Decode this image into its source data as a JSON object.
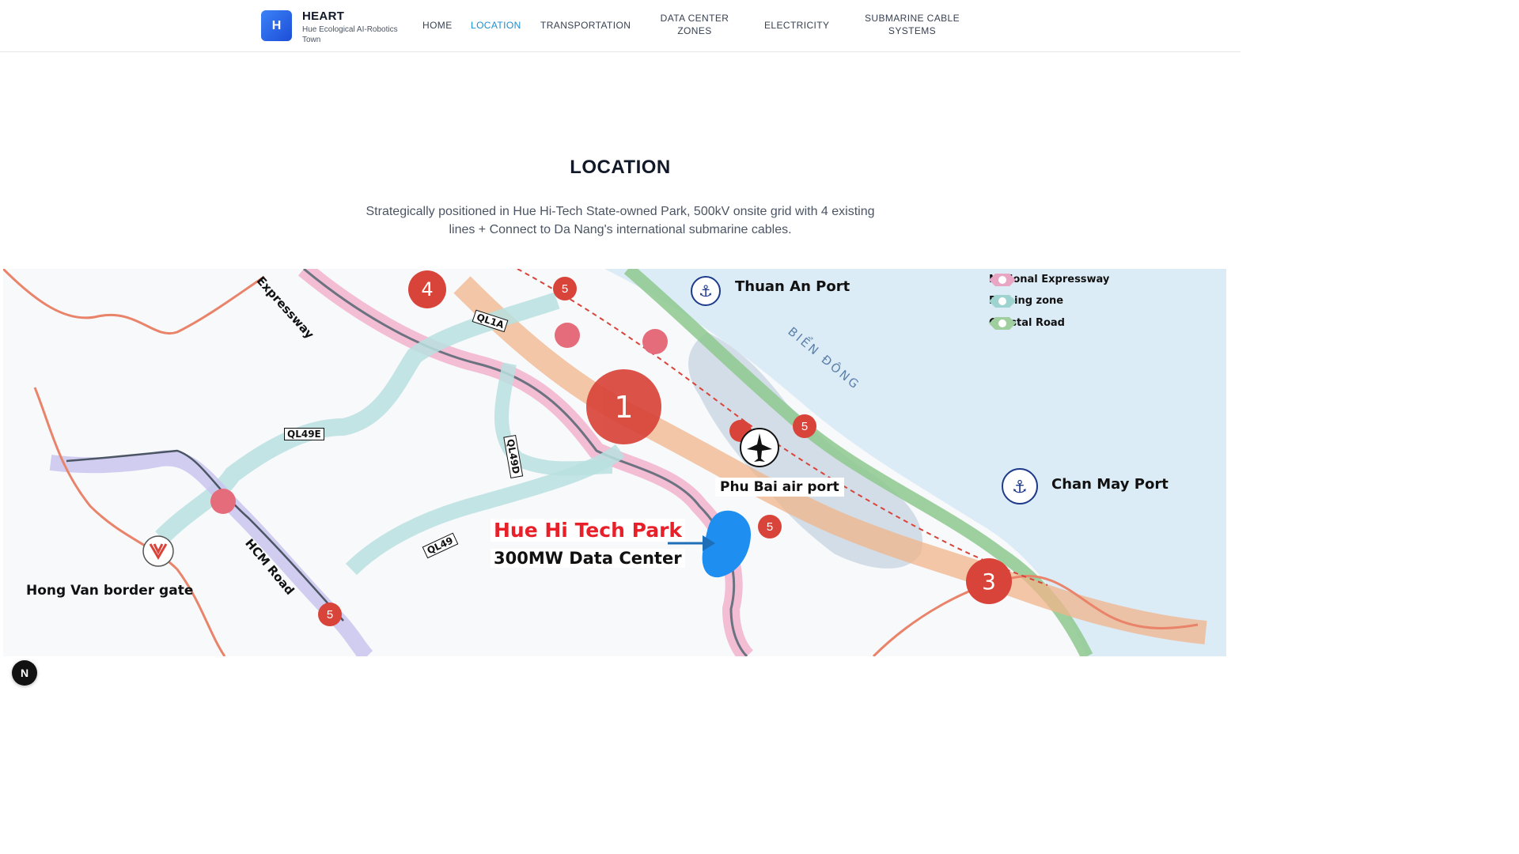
{
  "brand": {
    "logo_letter": "H",
    "title": "HEART",
    "subtitle": "Hue Ecological AI-Robotics Town"
  },
  "nav": {
    "home": "HOME",
    "location": "LOCATION",
    "transportation": "TRANSPORTATION",
    "data_center_zones": "DATA CENTER ZONES",
    "electricity": "ELECTRICITY",
    "submarine_cable_systems": "SUBMARINE CABLE SYSTEMS",
    "active": "LOCATION"
  },
  "section": {
    "title": "LOCATION",
    "description": "Strategically positioned in Hue Hi-Tech State-owned Park, 500kV onsite grid with 4 existing lines + Connect to Da Nang's international submarine cables."
  },
  "map": {
    "labels": {
      "thuan_an_port": "Thuan An Port",
      "chan_may_port": "Chan May Port",
      "phu_bai_airport": "Phu Bai air port",
      "hong_van_border_gate": "Hong Van border gate",
      "hue_hi_tech_park": "Hue Hi Tech Park",
      "data_center": "300MW Data Center",
      "bien_dong": "BIỂN ĐÔNG",
      "expressway": "Expressway",
      "hcm_road": "HCM Road",
      "ql1a": "QL1A",
      "ql49e": "QL49E",
      "ql49d": "QL49D",
      "ql49": "QL49"
    },
    "markers": {
      "big_one": "1",
      "three": "3",
      "four": "4",
      "five": "5"
    },
    "legend": [
      {
        "label": "National Expressway",
        "color": "#e8a6c4"
      },
      {
        "label": "Planing zone",
        "color": "#9fd3cf"
      },
      {
        "label": "Coastal Road",
        "color": "#9fcf9f"
      }
    ],
    "colors": {
      "expressway": "#f2b6cf",
      "planning_zone": "#b8e0df",
      "coastal_road": "#8ec98e",
      "orange_corridor": "#f0b48a",
      "sea": "#dcecf7",
      "border": "#e9836a",
      "marker": "#d9443a",
      "data_center": "#1f8ef1"
    }
  },
  "footer_badge": "N"
}
